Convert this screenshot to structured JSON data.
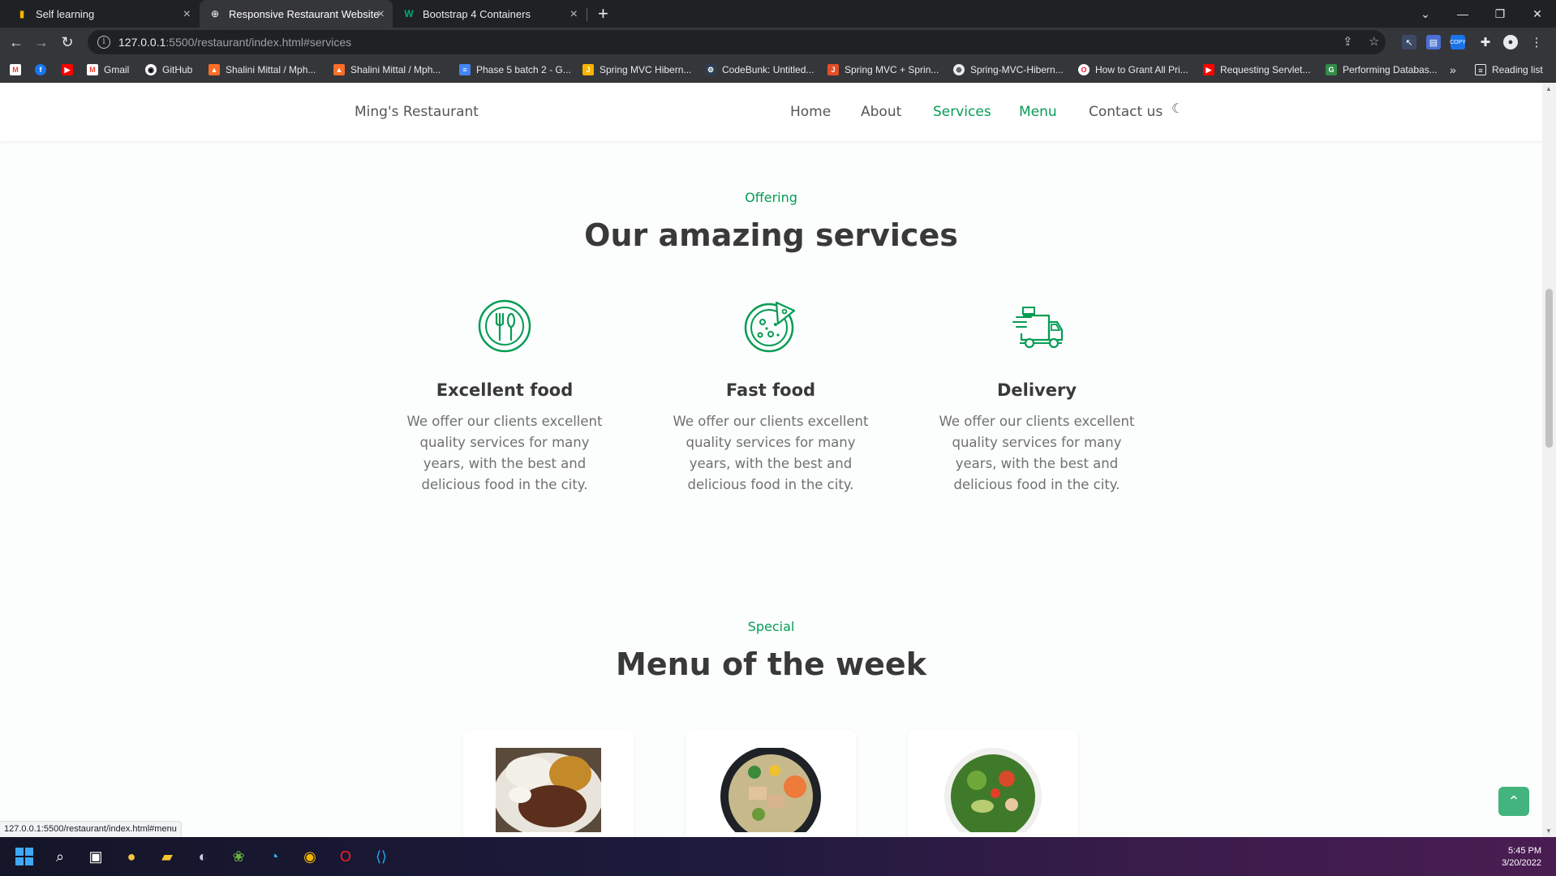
{
  "browser": {
    "tabs": [
      {
        "title": "Self learning",
        "active": false
      },
      {
        "title": "Responsive Restaurant Website",
        "active": true
      },
      {
        "title": "Bootstrap 4 Containers",
        "active": false
      }
    ],
    "url_host": "127.0.0.1",
    "url_path": ":5500/restaurant/index.html#services",
    "bookmarks": [
      {
        "label": "Gmail"
      },
      {
        "label": "GitHub"
      },
      {
        "label": "Shalini Mittal / Mph..."
      },
      {
        "label": "Shalini Mittal / Mph..."
      },
      {
        "label": "Phase 5 batch 2 - G..."
      },
      {
        "label": "Spring MVC Hibern..."
      },
      {
        "label": "CodeBunk: Untitled..."
      },
      {
        "label": "Spring MVC + Sprin..."
      },
      {
        "label": "Spring-MVC-Hibern..."
      },
      {
        "label": "How to Grant All Pri..."
      },
      {
        "label": "Requesting Servlet..."
      },
      {
        "label": "Performing Databas..."
      }
    ],
    "bookmarks_overflow": "»",
    "reading_list": "Reading list",
    "status_url": "127.0.0.1:5500/restaurant/index.html#menu",
    "ext_copy": "COPY"
  },
  "site": {
    "logo": "Ming's Restaurant",
    "nav": [
      {
        "label": "Home",
        "active": false
      },
      {
        "label": "About",
        "active": false
      },
      {
        "label": "Services",
        "active": true
      },
      {
        "label": "Menu",
        "active": true
      },
      {
        "label": "Contact us",
        "active": false
      }
    ],
    "services_section": {
      "subtitle": "Offering",
      "title": "Our amazing services",
      "items": [
        {
          "title": "Excellent food",
          "description": "We offer our clients excellent quality services for many years, with the best and delicious food in the city.",
          "icon": "plate-cutlery-icon"
        },
        {
          "title": "Fast food",
          "description": "We offer our clients excellent quality services for many years, with the best and delicious food in the city.",
          "icon": "pizza-icon"
        },
        {
          "title": "Delivery",
          "description": "We offer our clients excellent quality services for many years, with the best and delicious food in the city.",
          "icon": "delivery-truck-icon"
        }
      ]
    },
    "menu_section": {
      "subtitle": "Special",
      "title": "Menu of the week"
    },
    "colors": {
      "accent": "#069c54",
      "title": "#393939",
      "text": "#707070"
    }
  },
  "taskbar": {
    "time": "5:45 PM",
    "date": "3/20/2022"
  }
}
